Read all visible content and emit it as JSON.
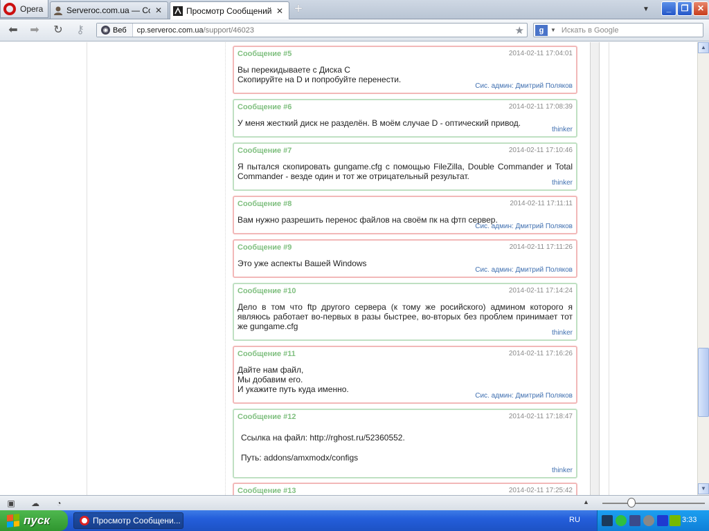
{
  "browser": {
    "menu_label": "Opera",
    "tabs": [
      {
        "title": "Serveroc.com.ua — Cou...",
        "active": false
      },
      {
        "title": "Просмотр Сообщений • ...",
        "active": true
      }
    ],
    "new_tab_symbol": "+",
    "window_buttons": {
      "minimize": "_",
      "restore": "❐",
      "close": "✕"
    }
  },
  "addressbar": {
    "site_label": "Веб",
    "url_host": "cp.serveroc.com.ua",
    "url_path": "/support/46023",
    "search_engine_badge": "g",
    "search_placeholder": "Искать в Google"
  },
  "messages": [
    {
      "title": "Сообщение #5",
      "date": "2014-02-11 17:04:01",
      "kind": "admin",
      "lines": [
        "Вы перекидываете с Диска C",
        "Скопируйте на D и попробуйте перенести."
      ],
      "signature": "Сис. админ: Дмитрий Поляков"
    },
    {
      "title": "Сообщение #6",
      "date": "2014-02-11 17:08:39",
      "kind": "user",
      "lines": [
        "У меня жесткий диск не разделён. В моём случае D - оптический привод."
      ],
      "signature": "thinker"
    },
    {
      "title": "Сообщение #7",
      "date": "2014-02-11 17:10:46",
      "kind": "user",
      "lines": [
        "Я пытался скопировать gungame.cfg с помощью FileZilla, Double Commander и Total Commander - везде один и тот же отрицательный результат."
      ],
      "signature": "thinker"
    },
    {
      "title": "Сообщение #8",
      "date": "2014-02-11 17:11:11",
      "kind": "admin",
      "lines": [
        "Вам нужно разрешить перенос файлов на своём пк на фтп сервер."
      ],
      "signature": "Сис. админ: Дмитрий Поляков"
    },
    {
      "title": "Сообщение #9",
      "date": "2014-02-11 17:11:26",
      "kind": "admin",
      "lines": [
        "Это уже аспекты Вашей Windows"
      ],
      "signature": "Сис. админ: Дмитрий Поляков"
    },
    {
      "title": "Сообщение #10",
      "date": "2014-02-11 17:14:24",
      "kind": "user",
      "lines": [
        "Дело в том что ftp другого сервера (к тому же росийского) админом которого я являюсь работает во-первых в разы быстрее, во-вторых без проблем принимает тот же gungame.cfg"
      ],
      "signature": "thinker"
    },
    {
      "title": "Сообщение #11",
      "date": "2014-02-11 17:16:26",
      "kind": "admin",
      "lines": [
        "Дайте нам файл,",
        "Мы добавим его.",
        "И укажите путь куда именно."
      ],
      "signature": "Сис. админ: Дмитрий Поляков"
    },
    {
      "title": "Сообщение #12",
      "date": "2014-02-11 17:18:47",
      "kind": "user",
      "lines": [
        "Ссылка на файл: http://rghost.ru/52360552.",
        "",
        "Путь: addons/amxmodx/configs"
      ],
      "signature": "thinker"
    },
    {
      "title": "Сообщение #13",
      "date": "2014-02-11 17:25:42",
      "kind": "admin",
      "lines": [],
      "signature": ""
    }
  ],
  "statusbar": {
    "scroll_up_symbol": "▲"
  },
  "taskbar": {
    "start_label": "пуск",
    "task_title": "Просмотр Сообщени...",
    "language": "RU",
    "clock": "3:33"
  },
  "colors": {
    "admin_border": "#f2b8b8",
    "user_border": "#bfe0c2",
    "message_title": "#7fbf7f",
    "signature": "#3f6fb0"
  }
}
